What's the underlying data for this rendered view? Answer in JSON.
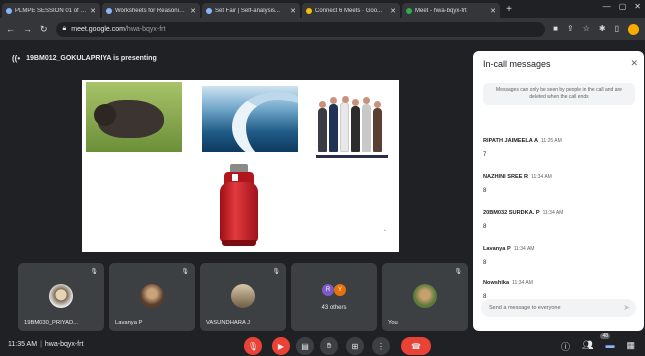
{
  "browser": {
    "tabs": [
      {
        "label": "PLMPE SESSION 01 of 11..."
      },
      {
        "label": "Worksheets for Reasoning..."
      },
      {
        "label": "Set Fair | Self-analysis..."
      },
      {
        "label": "Connect 6 Meets · Goo..."
      },
      {
        "label": "Meet - hwa-bqyx-frt"
      }
    ],
    "url_host": "meet.google.com",
    "url_path": "/hwa-bqyx-frt"
  },
  "meet": {
    "presenter_label": "19BM012_GOKULAPRIYA is presenting",
    "tiles": [
      {
        "name": "19BM030_PRIYAD..."
      },
      {
        "name": "Lavanya P"
      },
      {
        "name": "VASUNDHARA J"
      },
      {
        "name": "",
        "count": "43 others",
        "initials": [
          "R",
          "Y"
        ]
      },
      {
        "name": "You"
      }
    ],
    "meeting_time": "11:35 AM",
    "meeting_code": "hwa-bqyx-frt",
    "participant_badge": "48"
  },
  "chat": {
    "title": "In-call messages",
    "notice": "Messages can only be seen by people in the call and are deleted when the call ends",
    "messages": [
      {
        "sender": "RIPATH JAIMEELA A",
        "time": "11:25 AM",
        "text": "7"
      },
      {
        "sender": "NAZHINI SREE R",
        "time": "11:34 AM",
        "text": "8"
      },
      {
        "sender": "20BM032 SURDKA. P",
        "time": "11:34 AM",
        "text": "8"
      },
      {
        "sender": "Lavanya P",
        "time": "11:34 AM",
        "text": "8"
      },
      {
        "sender": "Nowshika",
        "time": "11:34 AM",
        "text": "8"
      }
    ],
    "input_placeholder": "Send a message to everyone"
  },
  "colors": {
    "background": "#202124",
    "tile": "#3c4043",
    "end_call": "#ea4335",
    "accent": "#8ab4f8"
  }
}
